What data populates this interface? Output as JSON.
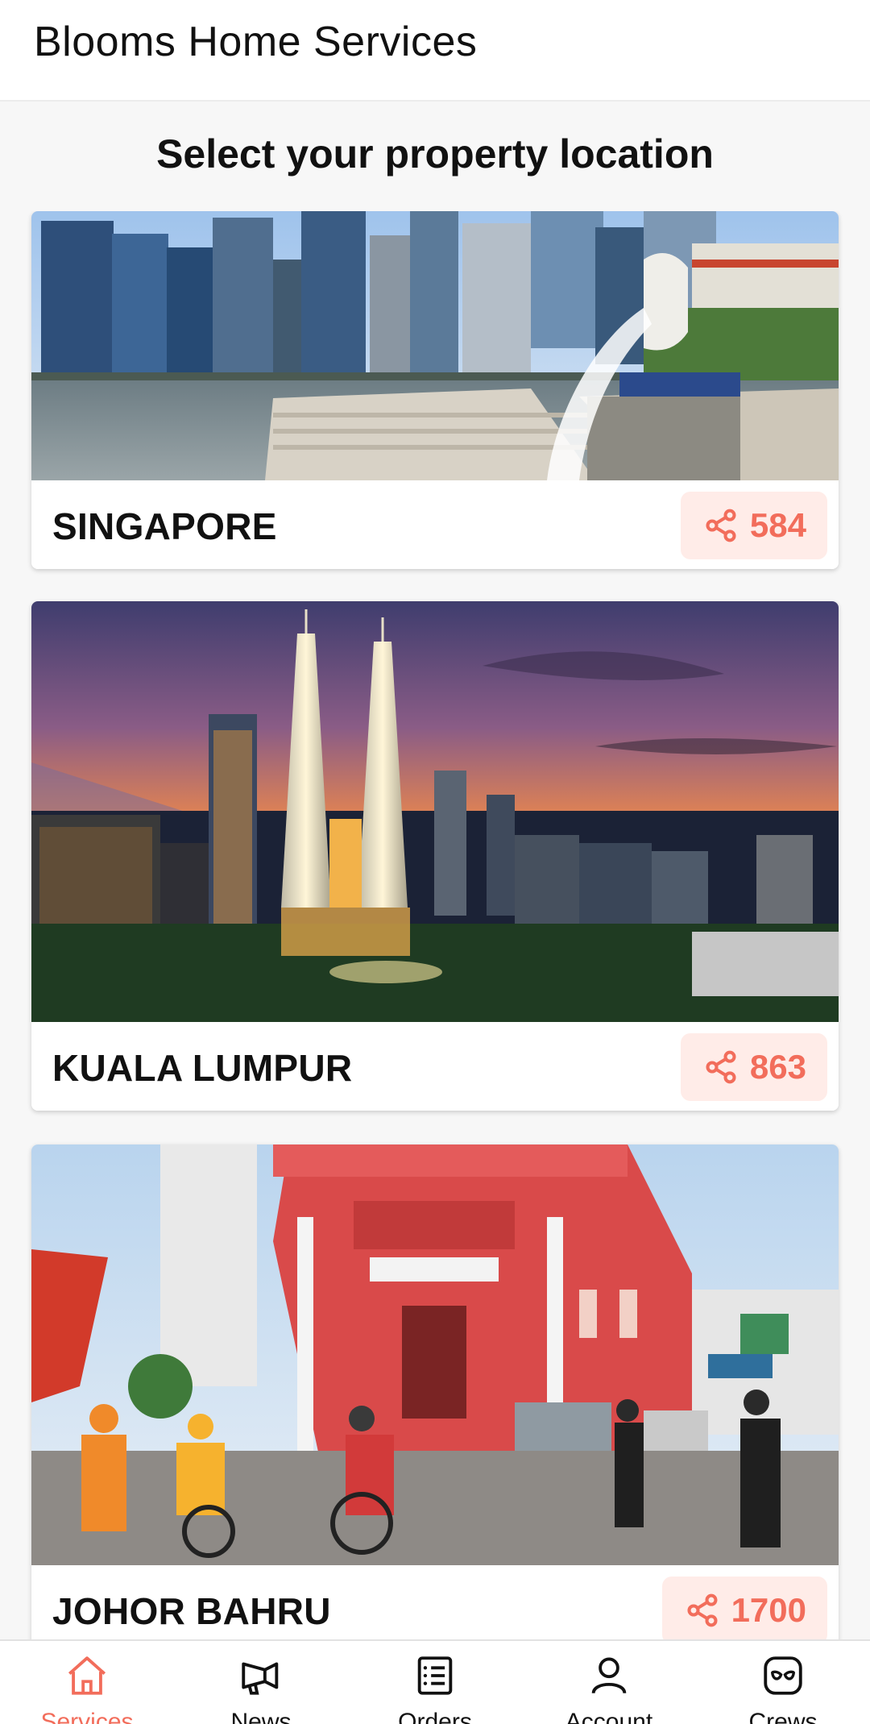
{
  "header": {
    "title": "Blooms Home Services"
  },
  "page": {
    "heading": "Select your property location"
  },
  "locations": [
    {
      "name": "SINGAPORE",
      "count": "584",
      "image": "singapore-skyline-merlion"
    },
    {
      "name": "KUALA LUMPUR",
      "count": "863",
      "image": "kuala-lumpur-petronas-towers-sunset"
    },
    {
      "name": "JOHOR BAHRU",
      "count": "1700",
      "image": "johor-bahru-red-house-street"
    }
  ],
  "nav": {
    "items": [
      {
        "label": "Services",
        "icon": "home-icon",
        "active": true
      },
      {
        "label": "News",
        "icon": "megaphone-icon",
        "active": false
      },
      {
        "label": "Orders",
        "icon": "list-icon",
        "active": false
      },
      {
        "label": "Account",
        "icon": "user-icon",
        "active": false
      },
      {
        "label": "Crews",
        "icon": "crews-icon",
        "active": false
      }
    ]
  },
  "colors": {
    "accent": "#f26d5b",
    "share_bg": "#ffece8"
  }
}
